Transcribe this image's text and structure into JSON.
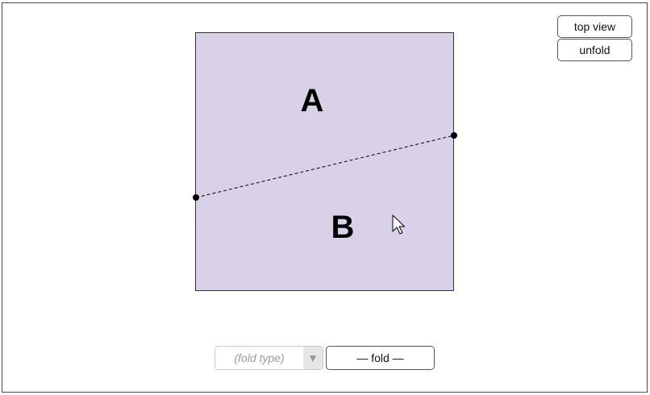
{
  "controls": {
    "top_view_label": "top view",
    "unfold_label": "unfold",
    "fold_type_placeholder": "(fold type)",
    "fold_label": "— fold —"
  },
  "paper": {
    "color": "#d9d1e8",
    "border_color": "#333333",
    "regions": [
      {
        "id": "A",
        "label": "A"
      },
      {
        "id": "B",
        "label": "B"
      }
    ],
    "fold_line": {
      "style": "dashed",
      "endpoint_markers": 2
    }
  },
  "icons": {
    "dropdown_arrow": "triangle-down",
    "cursor": "mouse-pointer-icon"
  }
}
